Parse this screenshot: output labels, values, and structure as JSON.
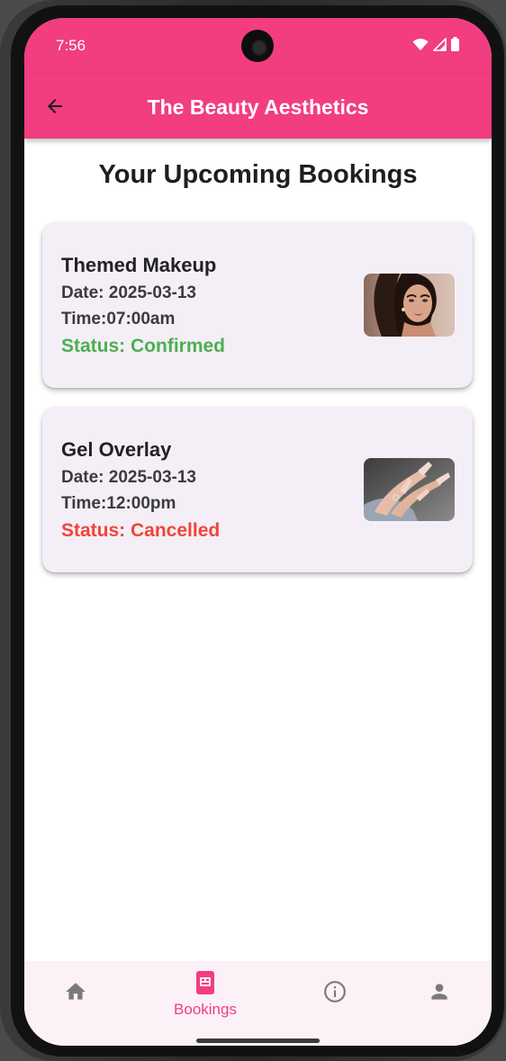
{
  "status_bar": {
    "time": "7:56"
  },
  "app_bar": {
    "title": "The Beauty Aesthetics",
    "back_icon": "arrow-back-icon"
  },
  "page": {
    "title": "Your Upcoming Bookings"
  },
  "bookings": [
    {
      "service": "Themed Makeup",
      "date": "Date: 2025-03-13",
      "time": "Time:07:00am",
      "status": "Status: Confirmed",
      "status_color": "#4caf50",
      "image": "makeup-model-photo"
    },
    {
      "service": "Gel Overlay",
      "date": "Date: 2025-03-13",
      "time": "Time:12:00pm",
      "status": "Status: Cancelled",
      "status_color": "#f44336",
      "image": "gel-nails-photo"
    }
  ],
  "bottom_nav": {
    "items": [
      {
        "icon": "home-icon",
        "label": ""
      },
      {
        "icon": "bookings-icon",
        "label": "Bookings"
      },
      {
        "icon": "info-icon",
        "label": ""
      },
      {
        "icon": "person-icon",
        "label": ""
      }
    ],
    "active_index": 1,
    "active_color": "#f23d80",
    "inactive_color": "#7a7a7a"
  },
  "colors": {
    "primary": "#f23d80",
    "card_background": "#f4eff7",
    "nav_background": "#fdf1f8"
  }
}
